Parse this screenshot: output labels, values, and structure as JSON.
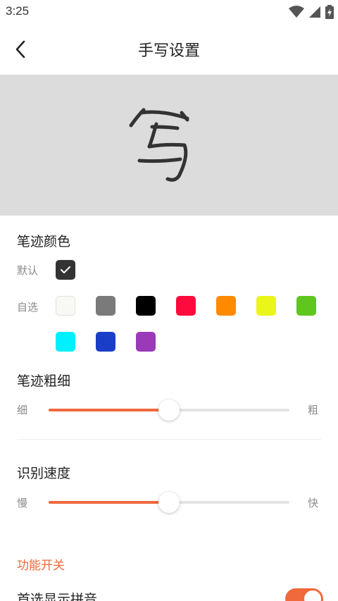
{
  "status_bar": {
    "time": "3:25"
  },
  "header": {
    "title": "手写设置"
  },
  "preview": {
    "sample_char": "写"
  },
  "stroke_color": {
    "title": "笔迹颜色",
    "default_label": "默认",
    "custom_label": "自选",
    "default_color": "#333333",
    "custom_colors": [
      "#f8f8f5",
      "#7a7a7a",
      "#000000",
      "#ff0a3c",
      "#ff8a00",
      "#eaf51a",
      "#5fc61d",
      "#00f0ff",
      "#1a3ec8",
      "#9a3ab8"
    ]
  },
  "stroke_width": {
    "title": "笔迹粗细",
    "min_label": "细",
    "max_label": "粗",
    "value_percent": 50
  },
  "recognition_speed": {
    "title": "识别速度",
    "min_label": "慢",
    "max_label": "快",
    "value_percent": 50
  },
  "features": {
    "title": "功能开关",
    "pinyin_label": "首选显示拼音",
    "pinyin_enabled": true
  },
  "colors": {
    "accent": "#f0693c",
    "preview_bg": "#dcdcdc"
  }
}
